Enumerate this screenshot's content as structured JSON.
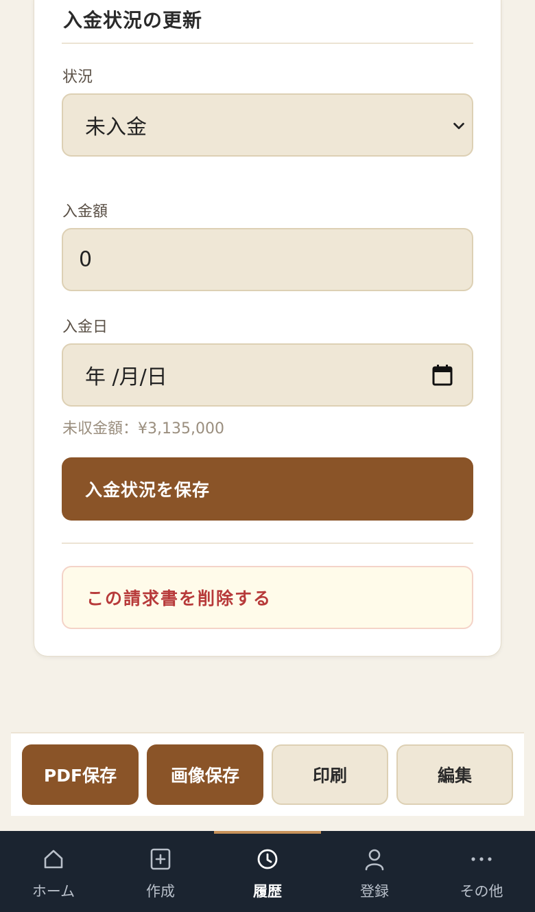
{
  "payment_section": {
    "title": "入金状況の更新",
    "status_label": "状況",
    "status_value": "未入金",
    "amount_label": "入金額",
    "amount_value": "0",
    "date_label": "入金日",
    "date_placeholder": "年 /月/日",
    "unpaid_note": "未収金額：¥3,135,000",
    "save_button": "入金状況を保存",
    "delete_button": "この請求書を削除する"
  },
  "actions": {
    "pdf": "PDF保存",
    "image": "画像保存",
    "print": "印刷",
    "edit": "編集"
  },
  "nav": {
    "active": "history",
    "items": [
      {
        "id": "home",
        "label": "ホーム",
        "icon": "home-icon"
      },
      {
        "id": "create",
        "label": "作成",
        "icon": "plus-square-icon"
      },
      {
        "id": "history",
        "label": "履歴",
        "icon": "clock-icon"
      },
      {
        "id": "register",
        "label": "登録",
        "icon": "user-icon"
      },
      {
        "id": "other",
        "label": "その他",
        "icon": "more-icon"
      }
    ]
  },
  "colors": {
    "primary": "#8a5428",
    "background": "#f5f1e8",
    "field": "#efe7d6",
    "danger": "#b73a3a",
    "nav_background": "#1b2430",
    "nav_indicator": "#c8925a"
  }
}
